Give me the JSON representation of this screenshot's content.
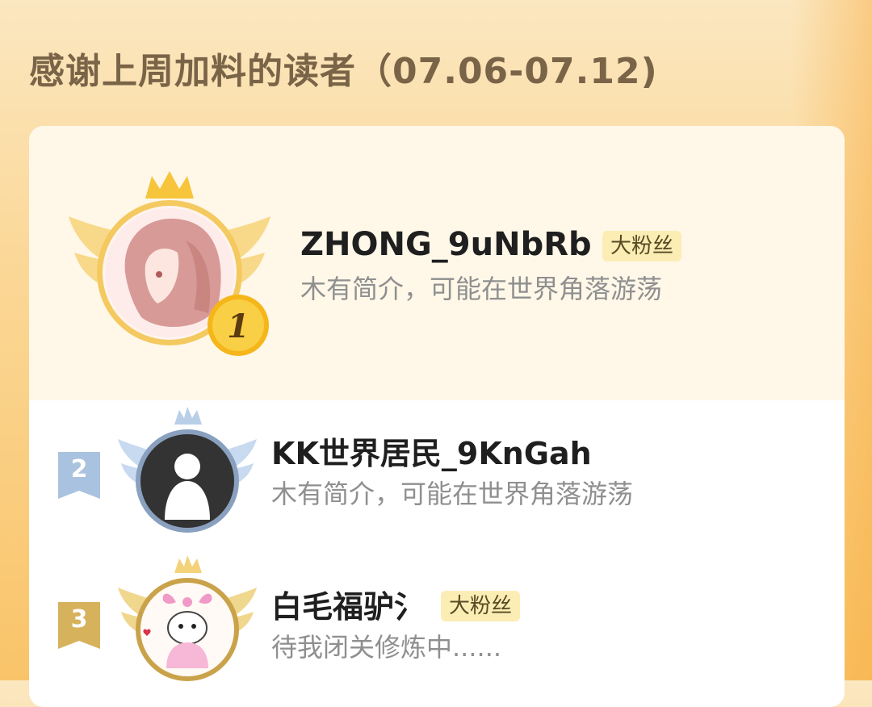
{
  "header": {
    "title": "感谢上周加料的读者（07.06-07.12)"
  },
  "readers": [
    {
      "rank": "1",
      "name": "ZHONG_9uNbRb",
      "badge": "大粉丝",
      "bio": "木有简介，可能在世界角落游荡",
      "frame": "gold"
    },
    {
      "rank": "2",
      "name": "KK世界居民_9KnGah",
      "badge": "",
      "bio": "木有简介，可能在世界角落游荡",
      "frame": "silver"
    },
    {
      "rank": "3",
      "name": "白毛福驴氵",
      "badge": "大粉丝",
      "bio": "待我闭关修炼中......",
      "frame": "bronze"
    }
  ],
  "colors": {
    "gold": "#f7c53b",
    "silver": "#9fb9d8",
    "bronze": "#d8b35a",
    "badge_bg": "#fbedb4"
  }
}
